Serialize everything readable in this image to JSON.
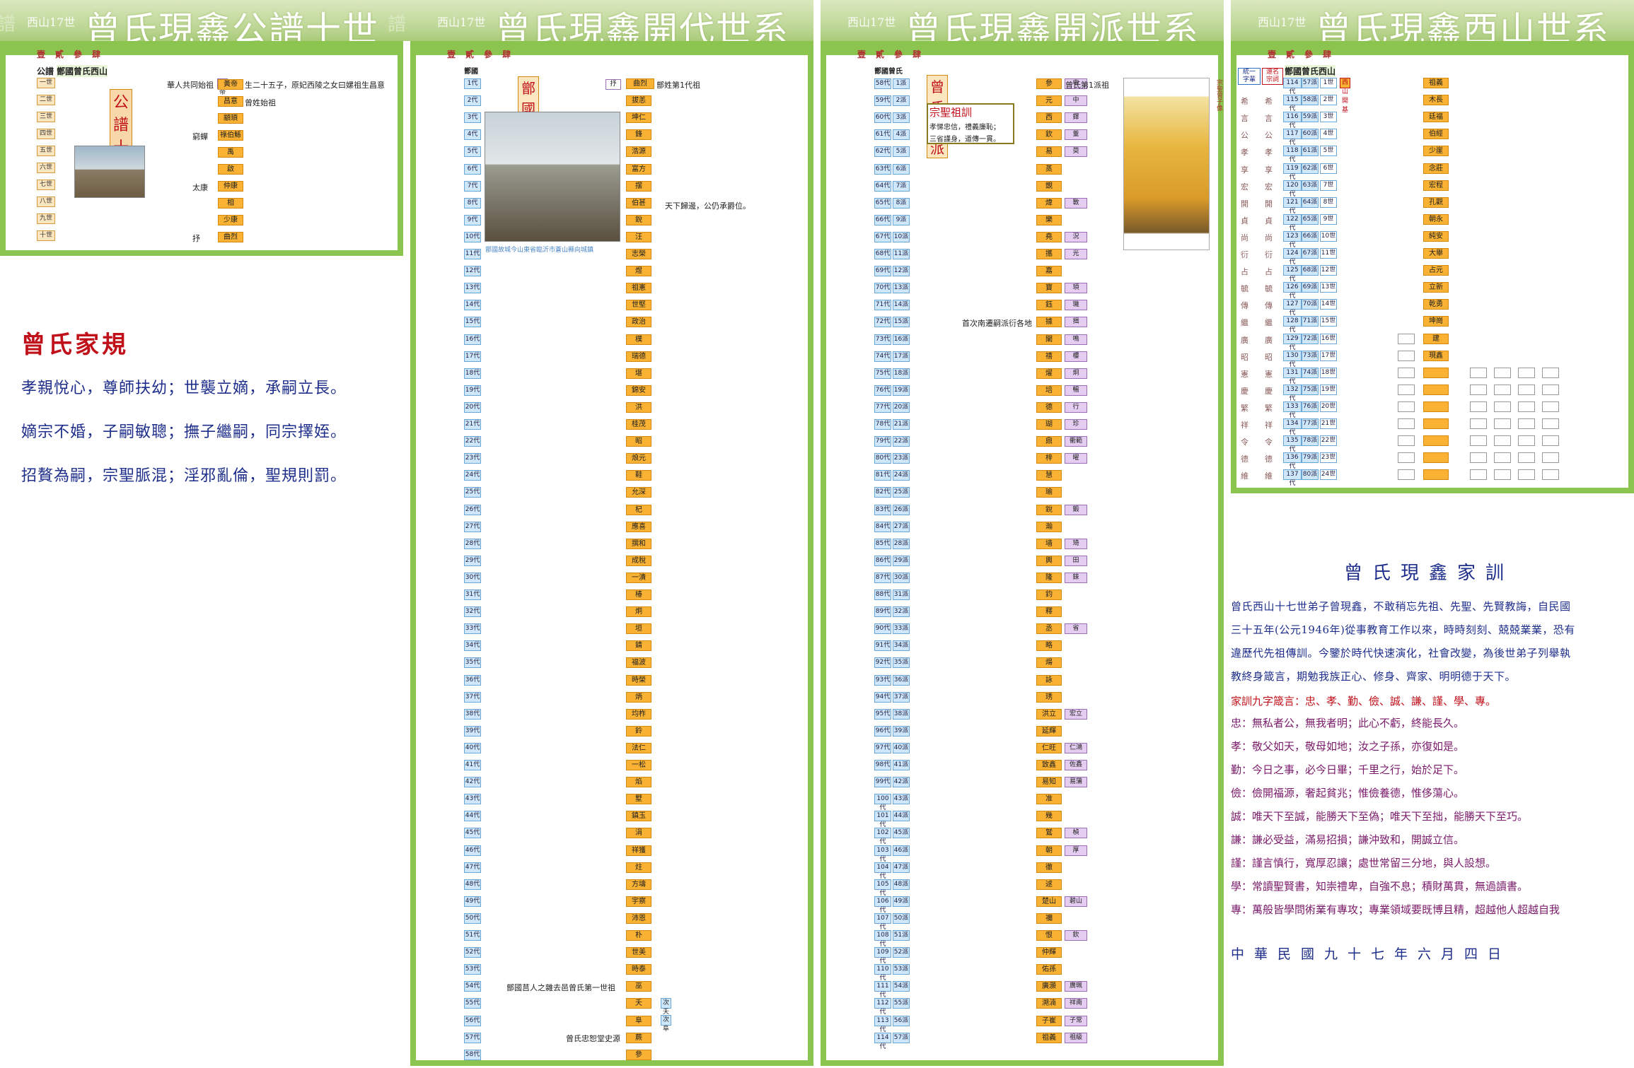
{
  "tabs": [
    "壹",
    "貳",
    "參",
    "肆"
  ],
  "panel1": {
    "small": "西山17世",
    "title": "曾氏現鑫公譜十世",
    "header": "公譜",
    "header2": "鄫國曾氏西山",
    "badge": "公譜十世",
    "note": "華人共同始祖",
    "note2": "黃帝",
    "note3": "生二十五子，原妃西陵之女曰嫘祖生昌意",
    "gens": [
      "一世",
      "二世",
      "三世",
      "四世",
      "五世",
      "六世",
      "七世",
      "八世",
      "九世",
      "十世"
    ],
    "names": [
      "黃帝",
      "昌意",
      "顓頊",
      "祿伯鯀",
      "禹",
      "啟",
      "仲康",
      "相",
      "少康",
      "曲烈"
    ],
    "side": [
      "",
      "曾姓始祖",
      "",
      "窮蟬",
      "",
      "",
      "太康",
      "",
      "",
      "抒"
    ]
  },
  "rules": {
    "title": "曾氏家規",
    "lines": [
      "孝親悅心，尊師扶幼；世襲立嫡，承嗣立長。",
      "嫡宗不婚，子嗣敏聰；撫子繼嗣，同宗擇姪。",
      "招贅為嗣，宗聖脈混；淫邪亂倫，聖規則罰。"
    ]
  },
  "panel2": {
    "small": "西山17世",
    "title": "曾氏現鑫開代世系",
    "header": "鄫國",
    "badge": "鄫國開代",
    "first_name": "曲烈",
    "first_note": "鄫姓第1代祖",
    "side_label": "抒",
    "caption": "鄫國故城今山東省臨沂市蒼山縣向城鎮",
    "note_8": "天下歸邊，公仍承爵位。",
    "note_54": "鄫國莒人之雜去邑曾氏第一世祖",
    "note_57": "曾氏忠恕堂史源",
    "gens": [
      "1代",
      "2代",
      "3代",
      "4代",
      "5代",
      "6代",
      "7代",
      "8代",
      "9代",
      "10代",
      "11代",
      "12代",
      "13代",
      "14代",
      "15代",
      "16代",
      "17代",
      "18代",
      "19代",
      "20代",
      "21代",
      "22代",
      "23代",
      "24代",
      "25代",
      "26代",
      "27代",
      "28代",
      "29代",
      "30代",
      "31代",
      "32代",
      "33代",
      "34代",
      "35代",
      "36代",
      "37代",
      "38代",
      "39代",
      "40代",
      "41代",
      "42代",
      "43代",
      "44代",
      "45代",
      "46代",
      "47代",
      "48代",
      "49代",
      "50代",
      "51代",
      "52代",
      "53代",
      "54代",
      "55代",
      "56代",
      "57代",
      "58代"
    ],
    "names": [
      "曲烈",
      "拔恙",
      "坤仁",
      "鋒",
      "浩源",
      "富方",
      "摆",
      "伯甚",
      "銳",
      "汪",
      "志榮",
      "煜",
      "祖憲",
      "世堅",
      "政治",
      "樸",
      "瑞德",
      "堪",
      "錦安",
      "洪",
      "桂茂",
      "昭",
      "烺元",
      "鞋",
      "允深",
      "杞",
      "應喜",
      "撰和",
      "成稅",
      "一漬",
      "椿",
      "炯",
      "垣",
      "錆",
      "福波",
      "時榮",
      "炳",
      "均柞",
      "鈴",
      "法仁",
      "一松",
      "焰",
      "墅",
      "鎮玉",
      "涓",
      "祥獲",
      "炷",
      "方壔",
      "宇察",
      "沛恩",
      "朴",
      "世美",
      "時泰",
      "巫",
      "夭",
      "阜",
      "蕨",
      "參"
    ],
    "extra": {
      "55": "次夭",
      "56": "次阜"
    }
  },
  "panel3": {
    "small": "西山17世",
    "title": "曾氏現鑫開派世系",
    "header": "鄫國曾氏",
    "badge": "曾氏開派",
    "motto_title": "宗聖祖訓",
    "motto1": "孝悌忠信，禮義廉恥；",
    "motto2": "三省謹身，道傳一貫。",
    "first_note": "曾氏第1派祖",
    "side_note": "首次南遷嗣派衍各地",
    "portrait_caption": "宗聖曾子像",
    "gens": [
      "58代",
      "59代",
      "60代",
      "61代",
      "62代",
      "63代",
      "64代",
      "65代",
      "66代",
      "67代",
      "68代",
      "69代",
      "70代",
      "71代",
      "72代",
      "73代",
      "74代",
      "75代",
      "76代",
      "77代",
      "78代",
      "79代",
      "80代",
      "81代",
      "82代",
      "83代",
      "84代",
      "85代",
      "86代",
      "87代",
      "88代",
      "89代",
      "90代",
      "91代",
      "92代",
      "93代",
      "94代",
      "95代",
      "96代",
      "97代",
      "98代",
      "99代",
      "100代",
      "101代",
      "102代",
      "103代",
      "104代",
      "105代",
      "106代",
      "107代",
      "108代",
      "109代",
      "110代",
      "111代",
      "112代",
      "113代",
      "114代"
    ],
    "pai": [
      "1派",
      "2派",
      "3派",
      "4派",
      "5派",
      "6派",
      "7派",
      "8派",
      "9派",
      "10派",
      "11派",
      "12派",
      "13派",
      "14派",
      "15派",
      "16派",
      "17派",
      "18派",
      "19派",
      "20派",
      "21派",
      "22派",
      "23派",
      "24派",
      "25派",
      "26派",
      "27派",
      "28派",
      "29派",
      "30派",
      "31派",
      "32派",
      "33派",
      "34派",
      "35派",
      "36派",
      "37派",
      "38派",
      "39派",
      "40派",
      "41派",
      "42派",
      "43派",
      "44派",
      "45派",
      "46派",
      "47派",
      "48派",
      "49派",
      "50派",
      "51派",
      "52派",
      "53派",
      "54派",
      "55派",
      "56派",
      "57派"
    ],
    "names": [
      "參",
      "元",
      "西",
      "欽",
      "易",
      "蒸",
      "覬",
      "煒",
      "樂",
      "堯",
      "攜",
      "嘉",
      "寶",
      "鈺",
      "據",
      "闡",
      "禧",
      "燿",
      "培",
      "德",
      "瑚",
      "鼎",
      "梓",
      "慧",
      "瑜",
      "銳",
      "瀚",
      "墙",
      "輿",
      "隆",
      "鈞",
      "釋",
      "丞",
      "略",
      "煬",
      "詠",
      "琇",
      "洪立",
      "延輝",
      "仁旺",
      "致鑫",
      "易知",
      "准",
      "幾",
      "鷲",
      "朝",
      "徹",
      "逑",
      "楚山",
      "禰",
      "恨",
      "仲輝",
      "佑孫",
      "廣灝",
      "溯湳",
      "子崔",
      "祖義"
    ],
    "col2": [
      "申",
      "中",
      "鐸",
      "董",
      "萸",
      "",
      "",
      "斁",
      "",
      "況",
      "光",
      "",
      "頊",
      "璣",
      "揖",
      "鳴",
      "樓",
      "炯",
      "暢",
      "行",
      "珍",
      "衢範",
      "曜",
      "",
      "",
      "鍛",
      "",
      "琦",
      "田",
      "錸",
      "",
      "",
      "省",
      "",
      "",
      "",
      "",
      "宏立",
      "",
      "仁鴻",
      "佐鑫",
      "易蒲",
      "",
      "",
      "楨",
      "厚",
      "",
      "",
      "碧山",
      "",
      "欽",
      "",
      "",
      "廣珮",
      "祥南",
      "子常",
      "祖級"
    ]
  },
  "panel4": {
    "small": "西山17世",
    "title": "曾氏現鑫西山世系",
    "header": "鄫國曾氏西山",
    "left_badge1": "統一字輩",
    "left_badge2": "遠名宗詞",
    "first_note": "西山開基",
    "gens": [
      "114代",
      "115代",
      "116代",
      "117代",
      "118代",
      "119代",
      "120代",
      "121代",
      "122代",
      "123代",
      "124代",
      "125代",
      "126代",
      "127代",
      "128代",
      "129代",
      "130代",
      "131代",
      "132代",
      "133代",
      "134代",
      "135代",
      "136代",
      "137代"
    ],
    "pai": [
      "57派",
      "58派",
      "59派",
      "60派",
      "61派",
      "62派",
      "63派",
      "64派",
      "65派",
      "66派",
      "67派",
      "68派",
      "69派",
      "70派",
      "71派",
      "72派",
      "73派",
      "74派",
      "75派",
      "76派",
      "77派",
      "78派",
      "79派",
      "80派"
    ],
    "shi": [
      "1世",
      "2世",
      "3世",
      "4世",
      "5世",
      "6世",
      "7世",
      "8世",
      "9世",
      "10世",
      "11世",
      "12世",
      "13世",
      "14世",
      "15世",
      "16世",
      "17世",
      "18世",
      "19世",
      "20世",
      "21世",
      "22世",
      "23世",
      "24世"
    ],
    "ancestral": [
      "希",
      "言",
      "公",
      "孝",
      "享",
      "宏",
      "開",
      "貞",
      "尚",
      "衍",
      "占",
      "毓",
      "傳",
      "繼",
      "廣",
      "昭",
      "憲",
      "慶",
      "繁",
      "祥",
      "令",
      "德",
      "維"
    ],
    "names": [
      "祖義",
      "木長",
      "廷福",
      "伯經",
      "少崖",
      "念莊",
      "宏程",
      "孔觀",
      "朝永",
      "純安",
      "大舉",
      "占元",
      "立新",
      "乾勇",
      "坤崗",
      "建",
      "現鑫",
      "",
      "",
      "",
      "",
      "",
      "",
      ""
    ],
    "footer_title": "曾氏現鑫家訓",
    "intro": [
      "曾氏西山十七世弟子曾現鑫，不敢稍忘先祖、先聖、先賢教誨，自民國",
      "三十五年(公元1946年)從事教育工作以來，時時刻刻、兢兢業業，恐有",
      "違歷代先祖傳訓。今鑒於時代快速演化，社會改變，為後世弟子列舉執",
      "教終身箴言，期勉我族正心、修身、齊家、明明德于天下。"
    ],
    "nine": "家訓九字箴言：忠、孝、勤、儉、誠、謙、謹、學、專。",
    "items": [
      "忠：無私者公，無我者明；此心不虧，終能長久。",
      "孝：敬父如天，敬母如地；汝之子孫，亦復如是。",
      "勤：今日之事，必今日畢；千里之行，始於足下。",
      "儉：儉開福源，奢起貧兆；惟儉養德，惟侈蕩心。",
      "誠：唯天下至誠，能勝天下至偽；唯天下至拙，能勝天下至巧。",
      "謙：謙必受益，滿易招損；謙沖致和，開誠立信。",
      "謹：謹言慎行，寬厚忍讓；處世常留三分地，與人設想。",
      "學：常讀聖賢書，知崇禮卑，自強不息；積財萬貫，無過讀書。",
      "專：萬般皆學問術業有專攻；專業領域要既博且精，超越他人超越自我"
    ],
    "date": "中華民國九十七年六月四日"
  },
  "colors": {
    "green": "#8cc450",
    "orange": "#f9b233",
    "blue": "#cfe7fb",
    "purple": "#e4cdf0",
    "red": "#c0101a"
  }
}
